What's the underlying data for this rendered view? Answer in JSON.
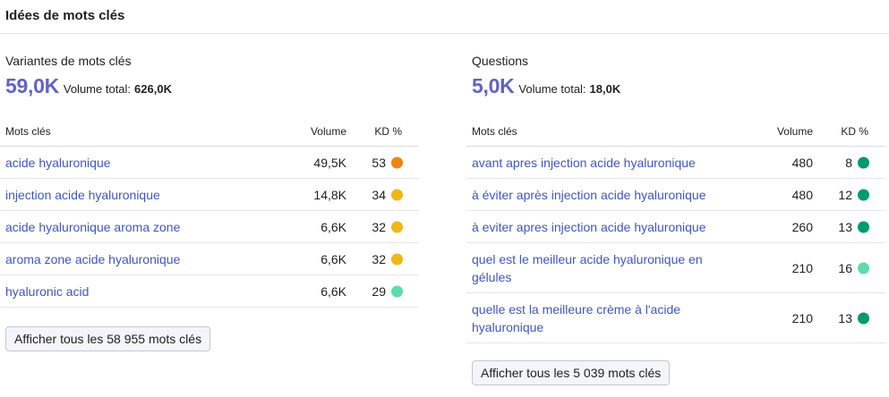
{
  "header": {
    "title": "Idées de mots clés"
  },
  "columns": {
    "keyword": "Mots clés",
    "volume": "Volume",
    "kd": "KD %"
  },
  "variants": {
    "title": "Variantes de mots clés",
    "count": "59,0K",
    "volume_label": "Volume total:",
    "volume_value": "626,0K",
    "rows": [
      {
        "keyword": "acide hyaluronique",
        "volume": "49,5K",
        "kd": "53",
        "color": "#ee8511"
      },
      {
        "keyword": "injection acide hyaluronique",
        "volume": "14,8K",
        "kd": "34",
        "color": "#f1b718"
      },
      {
        "keyword": "acide hyaluronique aroma zone",
        "volume": "6,6K",
        "kd": "32",
        "color": "#f1b718"
      },
      {
        "keyword": "aroma zone acide hyaluronique",
        "volume": "6,6K",
        "kd": "32",
        "color": "#f1b718"
      },
      {
        "keyword": "hyaluronic acid",
        "volume": "6,6K",
        "kd": "29",
        "color": "#5ddcab"
      }
    ],
    "button": "Afficher tous les 58 955 mots clés"
  },
  "questions": {
    "title": "Questions",
    "count": "5,0K",
    "volume_label": "Volume total:",
    "volume_value": "18,0K",
    "rows": [
      {
        "keyword": "avant apres injection acide hyaluronique",
        "volume": "480",
        "kd": "8",
        "color": "#029a6e"
      },
      {
        "keyword": "à éviter après injection acide hyaluronique",
        "volume": "480",
        "kd": "12",
        "color": "#029a6e"
      },
      {
        "keyword": "à eviter apres injection acide hyaluronique",
        "volume": "260",
        "kd": "13",
        "color": "#029a6e"
      },
      {
        "keyword": "quel est le meilleur acide hyaluronique en gélules",
        "volume": "210",
        "kd": "16",
        "color": "#5ddcab"
      },
      {
        "keyword": "quelle est la meilleure crème à l'acide hyaluronique",
        "volume": "210",
        "kd": "13",
        "color": "#029a6e"
      }
    ],
    "button": "Afficher tous les 5 039 mots clés"
  }
}
